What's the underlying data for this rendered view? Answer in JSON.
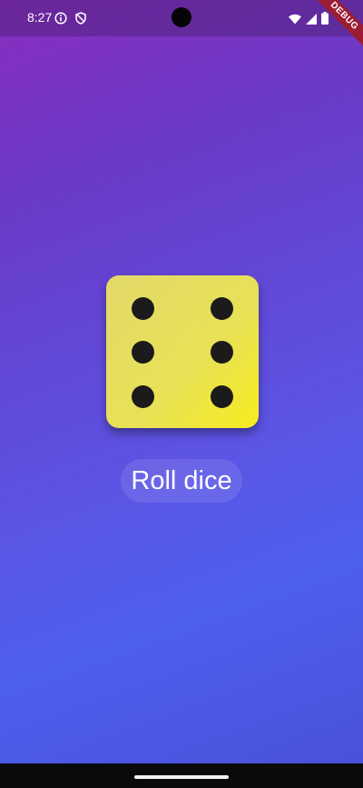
{
  "status_bar": {
    "time": "8:27",
    "icons_left": [
      "info-icon",
      "shield-icon"
    ],
    "icons_right": [
      "wifi-icon",
      "signal-icon",
      "battery-icon"
    ]
  },
  "debug_banner": {
    "label": "DEBUG",
    "color": "#9b1c33"
  },
  "dice": {
    "face_value": 6,
    "pip_color": "#1b1b1b",
    "face_color": "#e8e255"
  },
  "roll_button": {
    "label": "Roll dice"
  },
  "theme": {
    "gradient_start": "#8a2dbf",
    "gradient_end": "#4d5fef"
  }
}
